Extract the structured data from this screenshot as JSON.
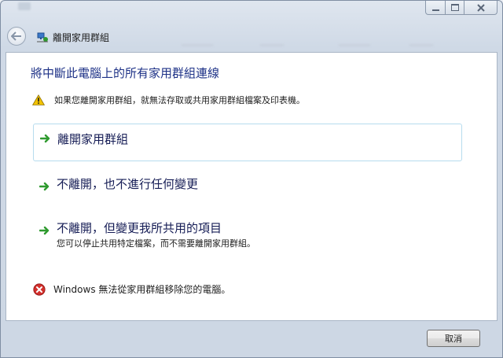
{
  "window": {
    "nav_title": "離開家用群組"
  },
  "main": {
    "heading": "將中斷此電腦上的所有家用群組連線",
    "warning": "如果您離開家用群組，就無法存取或共用家用群組檔案及印表機。",
    "options": [
      {
        "label": "離開家用群組"
      },
      {
        "label": "不離開，也不進行任何變更"
      },
      {
        "label": "不離開，但變更我所共用的項目",
        "description": "您可以停止共用特定檔案，而不需要離開家用群組。"
      }
    ],
    "error": "Windows 無法從家用群組移除您的電腦。"
  },
  "footer": {
    "cancel_label": "取消"
  },
  "colors": {
    "heading": "#1e3287",
    "link": "#151c55",
    "arrow": "#2f9a2f",
    "selection_border": "#b6dcee",
    "error": "#d3302c",
    "warning": "#f2c200"
  },
  "icons": {
    "back": "back-arrow-icon",
    "homegroup": "homegroup-icon",
    "warning": "warning-icon",
    "option_arrow": "green-arrow-icon",
    "error": "error-icon"
  }
}
